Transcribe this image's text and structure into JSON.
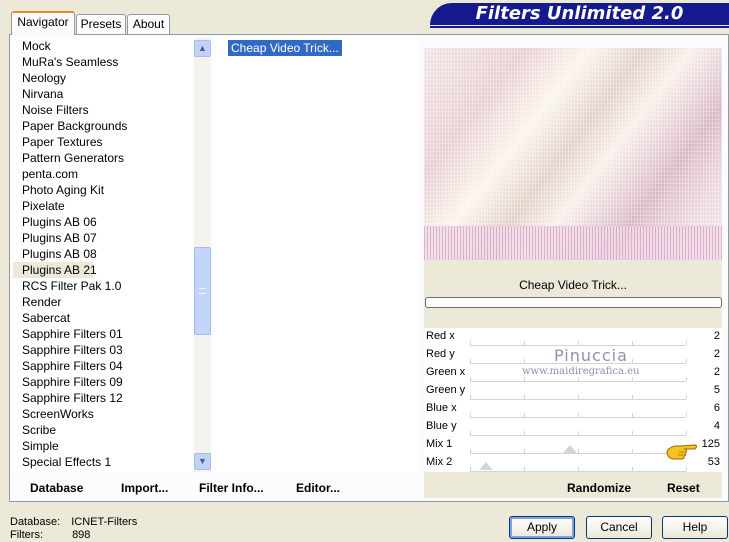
{
  "tabs": [
    {
      "label": "Navigator",
      "active": true
    },
    {
      "label": "Presets",
      "active": false
    },
    {
      "label": "About",
      "active": false
    }
  ],
  "banner": {
    "title": "Filters Unlimited 2.0"
  },
  "categories": [
    "Mock",
    "MuRa's Seamless",
    "Neology",
    "Nirvana",
    "Noise Filters",
    "Paper Backgrounds",
    "Paper Textures",
    "Pattern Generators",
    "penta.com",
    "Photo Aging Kit",
    "Pixelate",
    "Plugins AB 06",
    "Plugins AB 07",
    "Plugins AB 08",
    "Plugins AB 21",
    "RCS Filter Pak 1.0",
    "Render",
    "Sabercat",
    "Sapphire Filters 01",
    "Sapphire Filters 03",
    "Sapphire Filters 04",
    "Sapphire Filters 09",
    "Sapphire Filters 12",
    "ScreenWorks",
    "Scribe",
    "Simple",
    "Special Effects 1"
  ],
  "selected_category": "Plugins AB 21",
  "scrollbar_position": 0.62,
  "filters": [
    "Cheap Video Trick..."
  ],
  "current_filter": "Cheap Video Trick...",
  "progress": 0,
  "parameters": [
    {
      "label": "Red x",
      "value": "2"
    },
    {
      "label": "Red y",
      "value": "2"
    },
    {
      "label": "Green x",
      "value": "2"
    },
    {
      "label": "Green y",
      "value": "5"
    },
    {
      "label": "Blue x",
      "value": "6"
    },
    {
      "label": "Blue y",
      "value": "4"
    },
    {
      "label": "Mix 1",
      "value": "125"
    },
    {
      "label": "Mix 2",
      "value": "53"
    }
  ],
  "watermark": {
    "line1": "Pinuccia",
    "line2": "www.maidiregrafica.eu"
  },
  "actions": {
    "database": "Database",
    "import": "Import...",
    "filter_info": "Filter Info...",
    "editor": "Editor...",
    "randomize": "Randomize",
    "reset": "Reset"
  },
  "status": {
    "database_label": "Database:",
    "database_value": "ICNET-Filters",
    "filters_label": "Filters:",
    "filters_value": "898"
  },
  "buttons": {
    "apply": "Apply",
    "cancel": "Cancel",
    "help": "Help"
  },
  "icons": [
    "scroll-up-icon",
    "scroll-down-icon",
    "pointing-hand-icon"
  ]
}
